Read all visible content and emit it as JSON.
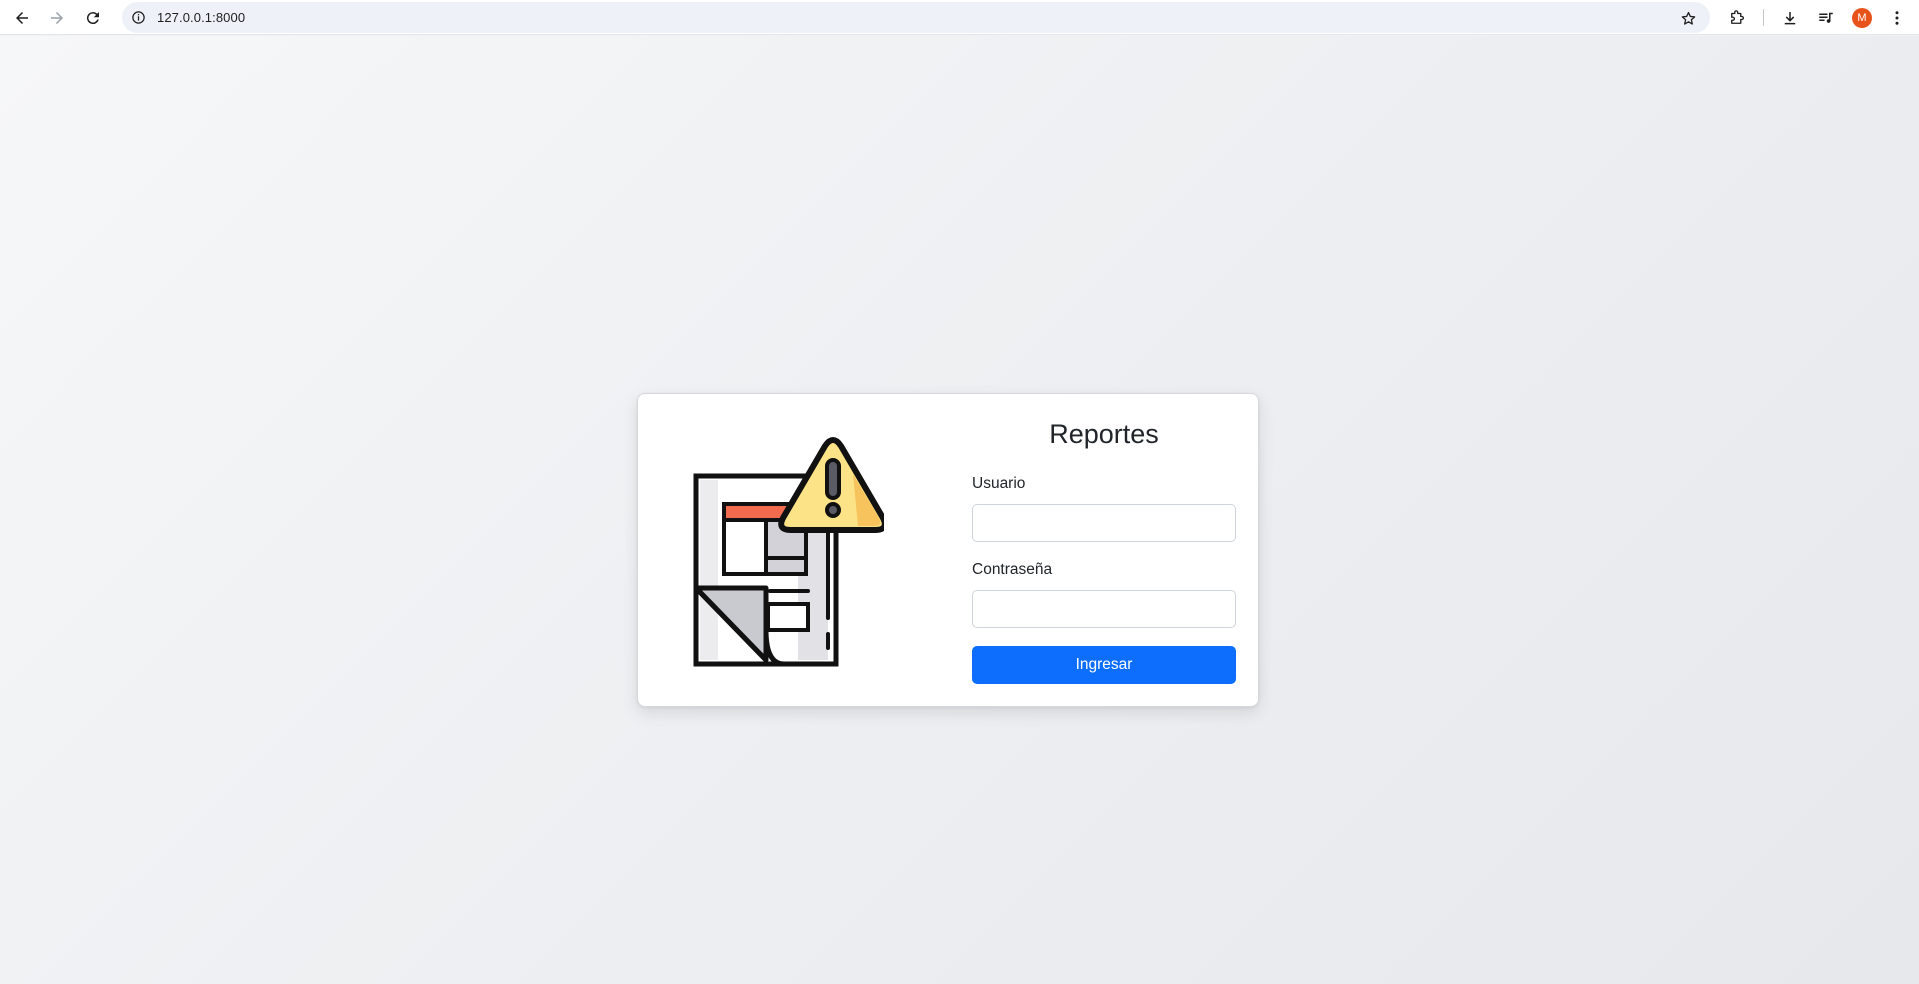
{
  "browser": {
    "url": "127.0.0.1:8000",
    "profile_initial": "M",
    "icons": [
      "back-icon",
      "forward-icon",
      "reload-icon",
      "site-info-icon",
      "bookmark-star-icon",
      "extensions-icon",
      "download-icon",
      "media-control-icon",
      "menu-kebab-icon"
    ]
  },
  "login": {
    "title": "Reportes",
    "username_label": "Usuario",
    "username_value": "",
    "password_label": "Contraseña",
    "password_value": "",
    "submit_label": "Ingresar",
    "illustration": "report-warning-icon"
  },
  "colors": {
    "primary": "#0d6efd",
    "warning_fill": "#fce387",
    "warning_shade": "#f6c35c",
    "report_header": "#f26b4f",
    "avatar": "#e8531c"
  }
}
